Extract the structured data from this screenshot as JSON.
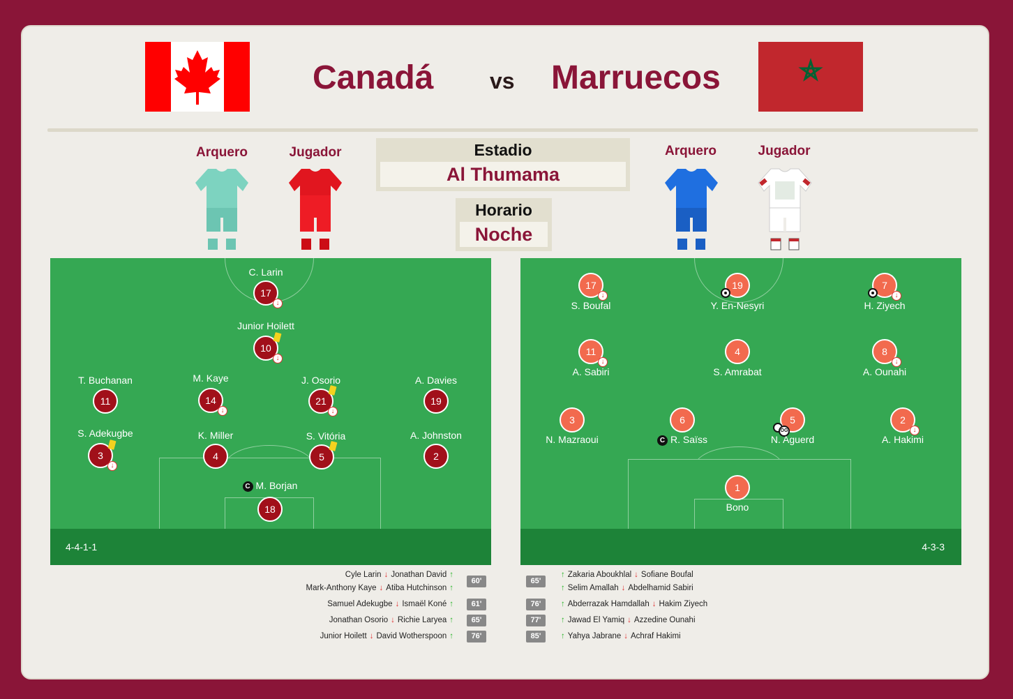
{
  "home": {
    "name": "Canadá"
  },
  "away": {
    "name": "Marruecos"
  },
  "vs": "vs",
  "kits": {
    "goalkeeper_label": "Arquero",
    "player_label": "Jugador"
  },
  "stadium": {
    "title": "Estadio",
    "value": "Al Thumama"
  },
  "time": {
    "title": "Horario",
    "value": "Noche"
  },
  "home_formation": "4-4-1-1",
  "away_formation": "4-3-3",
  "colors": {
    "background": "#8a1538",
    "pitch": "#35a853",
    "pitch_bar": "#1d8338",
    "home_player": "#a1101a",
    "away_player": "#f26a4e"
  },
  "home_players": [
    {
      "number": "17",
      "name": "C. Larin"
    },
    {
      "number": "10",
      "name": "Junior Hoilett"
    },
    {
      "number": "11",
      "name": "T. Buchanan"
    },
    {
      "number": "14",
      "name": "M. Kaye"
    },
    {
      "number": "21",
      "name": "J. Osorio"
    },
    {
      "number": "19",
      "name": "A. Davies"
    },
    {
      "number": "3",
      "name": "S. Adekugbe"
    },
    {
      "number": "4",
      "name": "K. Miller"
    },
    {
      "number": "5",
      "name": "S. Vitória"
    },
    {
      "number": "2",
      "name": "A. Johnston"
    },
    {
      "number": "18",
      "name": "M. Borjan"
    }
  ],
  "away_players": [
    {
      "number": "17",
      "name": "S. Boufal"
    },
    {
      "number": "19",
      "name": "Y. En-Nesyri"
    },
    {
      "number": "7",
      "name": "H. Ziyech"
    },
    {
      "number": "11",
      "name": "A. Sabiri"
    },
    {
      "number": "4",
      "name": "S. Amrabat"
    },
    {
      "number": "8",
      "name": "A. Ounahi"
    },
    {
      "number": "3",
      "name": "N. Mazraoui"
    },
    {
      "number": "6",
      "name": "R. Saïss"
    },
    {
      "number": "5",
      "name": "N. Aguerd"
    },
    {
      "number": "2",
      "name": "A. Hakimi"
    },
    {
      "number": "1",
      "name": "Bono"
    }
  ],
  "captain_glyph": "C",
  "own_goal_glyph": "OG",
  "home_subs": [
    {
      "minute": "60'",
      "rows": [
        {
          "out": "Cyle Larin",
          "in": "Jonathan David"
        },
        {
          "out": "Mark-Anthony Kaye",
          "in": "Atiba Hutchinson"
        }
      ]
    },
    {
      "minute": "61'",
      "rows": [
        {
          "out": "Samuel Adekugbe",
          "in": "Ismaël Koné"
        }
      ]
    },
    {
      "minute": "65'",
      "rows": [
        {
          "out": "Jonathan Osorio",
          "in": "Richie Laryea"
        }
      ]
    },
    {
      "minute": "76'",
      "rows": [
        {
          "out": "Junior Hoilett",
          "in": "David Wotherspoon"
        }
      ]
    }
  ],
  "away_subs": [
    {
      "minute": "65'",
      "rows": [
        {
          "in": "Zakaria Aboukhlal",
          "out": "Sofiane Boufal"
        },
        {
          "in": "Selim Amallah",
          "out": "Abdelhamid Sabiri"
        }
      ]
    },
    {
      "minute": "76'",
      "rows": [
        {
          "in": "Abderrazak Hamdallah",
          "out": "Hakim Ziyech"
        }
      ]
    },
    {
      "minute": "77'",
      "rows": [
        {
          "in": "Jawad El Yamiq",
          "out": "Azzedine Ounahi"
        }
      ]
    },
    {
      "minute": "85'",
      "rows": [
        {
          "in": "Yahya Jabrane",
          "out": "Achraf Hakimi"
        }
      ]
    }
  ],
  "arrows": {
    "up": "↑",
    "down": "↓"
  }
}
